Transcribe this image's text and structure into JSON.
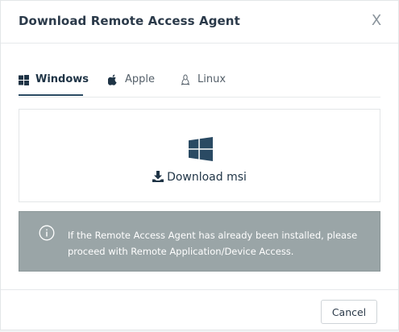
{
  "dialog": {
    "title": "Download Remote Access Agent",
    "close_label": "X"
  },
  "tabs": [
    {
      "label": "Windows",
      "icon": "windows-icon",
      "active": true
    },
    {
      "label": "Apple",
      "icon": "apple-icon",
      "active": false
    },
    {
      "label": "Linux",
      "icon": "linux-icon",
      "active": false
    }
  ],
  "download": {
    "platform_icon": "windows-logo-icon",
    "link_label": "Download msi",
    "link_icon": "download-icon"
  },
  "info": {
    "icon": "info-icon",
    "message": "If the Remote Access Agent has already been installed, please proceed with Remote Application/Device Access."
  },
  "footer": {
    "cancel_label": "Cancel"
  },
  "colors": {
    "primary_text": "#1f3446",
    "info_background": "#9aa5a7",
    "active_tab_underline": "#2a4a63"
  }
}
